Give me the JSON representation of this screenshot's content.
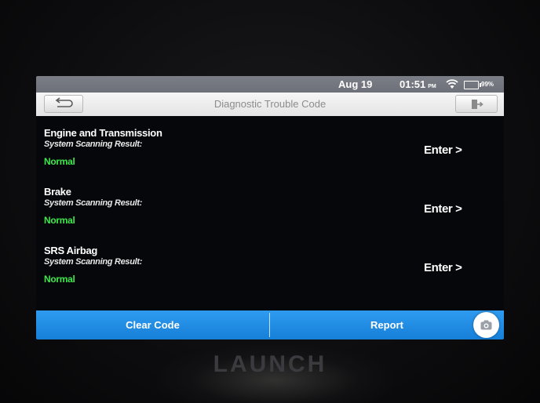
{
  "status_bar": {
    "date": "Aug 19",
    "time": "01:51",
    "ampm": "PM",
    "battery_percent": "99%",
    "wifi_icon": "wifi-icon",
    "battery_icon": "battery-icon"
  },
  "title_bar": {
    "title": "Diagnostic Trouble Code",
    "back_icon": "return-arrow-icon",
    "exit_icon": "exit-door-icon"
  },
  "systems": [
    {
      "name": "Engine and Transmission",
      "label": "System Scanning Result:",
      "result": "Normal",
      "action": "Enter >"
    },
    {
      "name": "Brake",
      "label": "System Scanning Result:",
      "result": "Normal",
      "action": "Enter >"
    },
    {
      "name": "SRS Airbag",
      "label": "System Scanning Result:",
      "result": "Normal",
      "action": "Enter >"
    }
  ],
  "bottom_bar": {
    "clear_label": "Clear Code",
    "report_label": "Report",
    "camera_icon": "camera-icon"
  },
  "device": {
    "brand": "LAUNCH"
  },
  "colors": {
    "status_bar": "#6d7078",
    "title_bar": "#e4e4e4",
    "result_normal": "#3de84a",
    "bottom_bar": "#1f8ce3"
  }
}
